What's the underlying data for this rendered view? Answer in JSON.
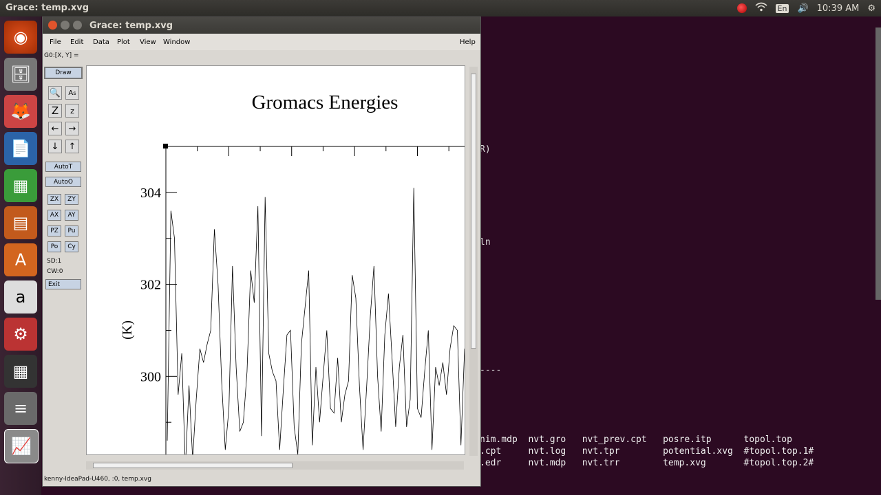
{
  "topbar": {
    "title": "Grace: temp.xvg",
    "keyboard": "En",
    "time": "10:39 AM"
  },
  "launcher": {
    "icons": [
      "ubuntu-dash-icon",
      "files-icon",
      "firefox-icon",
      "writer-icon",
      "calc-icon",
      "impress-icon",
      "software-center-icon",
      "amazon-icon",
      "system-settings-icon",
      "workspace-switcher-icon",
      "disks-icon",
      "grace-icon"
    ]
  },
  "grace": {
    "window_title": "Grace: temp.xvg",
    "menus": [
      "File",
      "Edit",
      "Data",
      "Plot",
      "View",
      "Window"
    ],
    "help": "Help",
    "locator": "G0:[X, Y] =",
    "draw": "Draw",
    "autot": "AutoT",
    "autoo": "AutoO",
    "zx": "ZX",
    "zy": "ZY",
    "ax": "AX",
    "ay": "AY",
    "pz": "PZ",
    "pu": "Pu",
    "po": "Po",
    "cy": "Cy",
    "sd": "SD:1",
    "cw": "CW:0",
    "exit": "Exit",
    "status": "kenny-IdeaPad-U460, :0, temp.xvg"
  },
  "chart_data": {
    "type": "line",
    "title": "Gromacs Energies",
    "ylabel": "(K)",
    "yticks": [
      "304",
      "302",
      "300"
    ],
    "ytick_values": [
      304,
      302,
      300
    ],
    "y_visible_range": [
      298.3,
      305.0
    ],
    "series": [
      {
        "values": [
          298.6,
          303.6,
          303.0,
          299.6,
          300.5,
          298.0,
          299.8,
          298.2,
          299.5,
          300.6,
          300.3,
          300.7,
          301.0,
          303.2,
          302.0,
          299.9,
          298.4,
          299.3,
          302.4,
          300.2,
          298.8,
          299.0,
          300.1,
          302.3,
          301.6,
          303.7,
          298.7,
          303.9,
          300.5,
          300.1,
          299.9,
          298.4,
          299.7,
          300.9,
          301.0,
          298.9,
          298.3,
          300.7,
          301.5,
          302.3,
          298.5,
          300.2,
          299.0,
          300.0,
          301.0,
          299.3,
          299.2,
          300.4,
          299.0,
          299.6,
          299.9,
          302.2,
          301.7,
          299.8,
          298.4,
          299.8,
          301.3,
          302.4,
          300.0,
          298.8,
          300.9,
          301.8,
          300.4,
          298.9,
          300.2,
          300.9,
          298.9,
          299.5,
          304.1,
          299.3,
          299.1,
          300.1,
          301.0,
          298.4,
          300.2,
          299.8,
          300.3,
          299.6,
          300.6,
          301.1,
          301.0,
          298.5,
          300.6
        ]
      }
    ]
  },
  "terminal": {
    "frag1": "R)",
    "frag2": "ln",
    "frag3": "----",
    "rows": [
      "nim.mdp  nvt.gro   nvt_prev.cpt   posre.itp      topol.top",
      ".cpt     nvt.log   nvt.tpr        potential.xvg  #topol.top.1#",
      ".edr     nvt.mdp   nvt.trr        temp.xvg       #topol.top.2#"
    ]
  }
}
